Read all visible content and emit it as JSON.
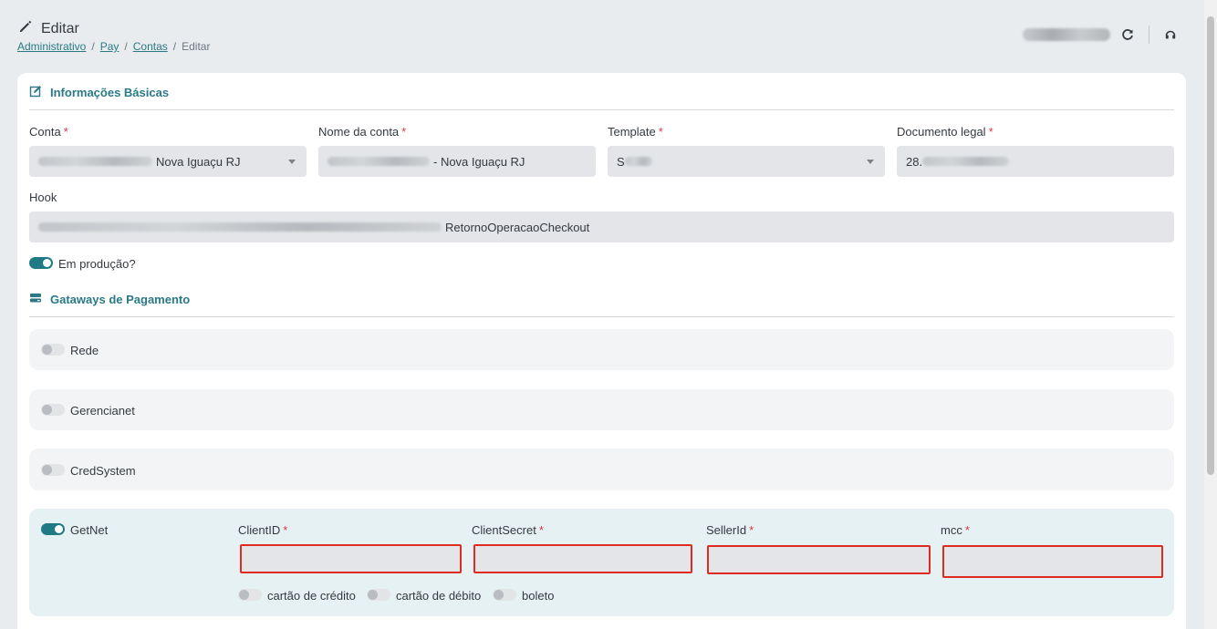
{
  "header": {
    "title": "Editar",
    "breadcrumb": [
      "Administrativo",
      "Pay",
      "Contas",
      "Editar"
    ]
  },
  "basic": {
    "section_title": "Informações Básicas",
    "conta_label": "Conta",
    "conta_value_visible": "Nova Iguaçu RJ",
    "nome_label": "Nome da conta",
    "nome_value_visible": "- Nova Iguaçu RJ",
    "template_label": "Template",
    "template_value_visible": "S",
    "documento_label": "Documento legal",
    "documento_value_visible": "28.",
    "hook_label": "Hook",
    "hook_value_visible": "RetornoOperacaoCheckout",
    "producao_label": "Em produção?",
    "producao_on": true,
    "required_mark": "*"
  },
  "gateways": {
    "section_title": "Gataways de Pagamento",
    "items": [
      {
        "name": "Rede",
        "enabled": false
      },
      {
        "name": "Gerencianet",
        "enabled": false
      },
      {
        "name": "CredSystem",
        "enabled": false
      },
      {
        "name": "GetNet",
        "enabled": true
      }
    ],
    "getnet_fields": [
      {
        "label": "ClientID",
        "value": ""
      },
      {
        "label": "ClientSecret",
        "value": ""
      },
      {
        "label": "SellerId",
        "value": ""
      },
      {
        "label": "mcc",
        "value": ""
      }
    ],
    "payment_methods": [
      {
        "label": "cartão de crédito",
        "enabled": false
      },
      {
        "label": "cartão de débito",
        "enabled": false
      },
      {
        "label": "boleto",
        "enabled": false
      }
    ]
  },
  "colors": {
    "accent": "#2a7a86",
    "toggle_on": "#1f7a86",
    "required": "#dc3545",
    "error_border": "#e02b20"
  },
  "icons": {
    "title": "pencil-icon",
    "refresh": "refresh-icon",
    "support": "headset-icon",
    "basic_section": "edit-square-icon",
    "gateway_section": "card-icon"
  }
}
